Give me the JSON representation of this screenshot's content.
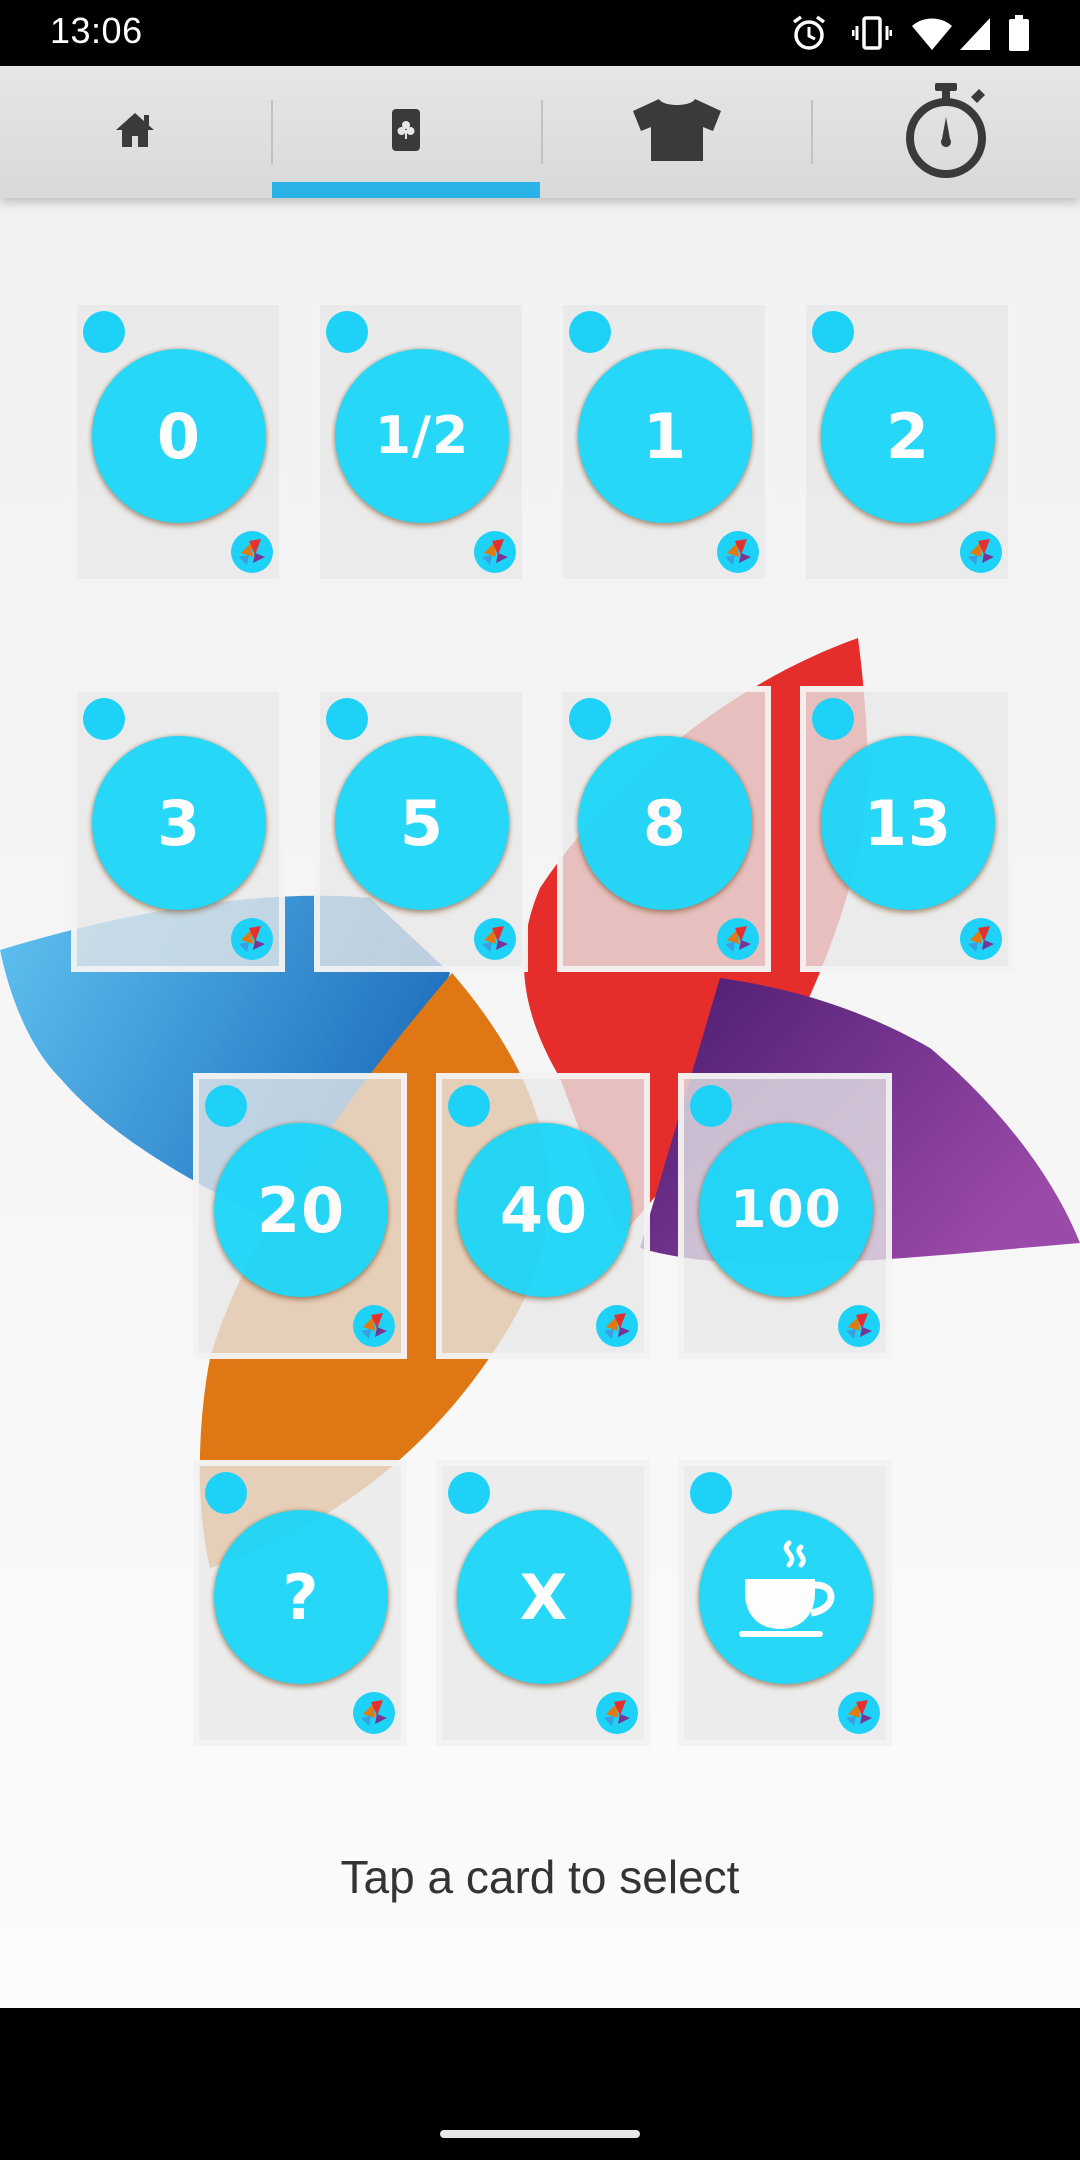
{
  "status_bar": {
    "time": "13:06",
    "icons": [
      "alarm-icon",
      "vibrate-icon",
      "wifi-icon",
      "signal-icon",
      "battery-icon"
    ]
  },
  "tabs": [
    {
      "name": "home",
      "icon": "home-icon",
      "selected": false
    },
    {
      "name": "cards",
      "icon": "card-icon",
      "selected": true
    },
    {
      "name": "shirt",
      "icon": "shirt-icon",
      "selected": false
    },
    {
      "name": "timer",
      "icon": "stopwatch-icon",
      "selected": false
    }
  ],
  "cards": [
    {
      "label": "0"
    },
    {
      "label": "1/2"
    },
    {
      "label": "1"
    },
    {
      "label": "2"
    },
    {
      "label": "3"
    },
    {
      "label": "5"
    },
    {
      "label": "8"
    },
    {
      "label": "13"
    },
    {
      "label": "20"
    },
    {
      "label": "40"
    },
    {
      "label": "100"
    },
    {
      "label": "?"
    },
    {
      "label": "X"
    },
    {
      "label": "",
      "icon": "coffee-cup-icon"
    }
  ],
  "hint": "Tap a card to select",
  "colors": {
    "accent": "#29b3e7",
    "card_circle": "#16d6fa",
    "pinwheel_blue": "#3a9ee0",
    "pinwheel_orange": "#e07a12",
    "pinwheel_red": "#e63030",
    "pinwheel_purple": "#7a3594"
  }
}
